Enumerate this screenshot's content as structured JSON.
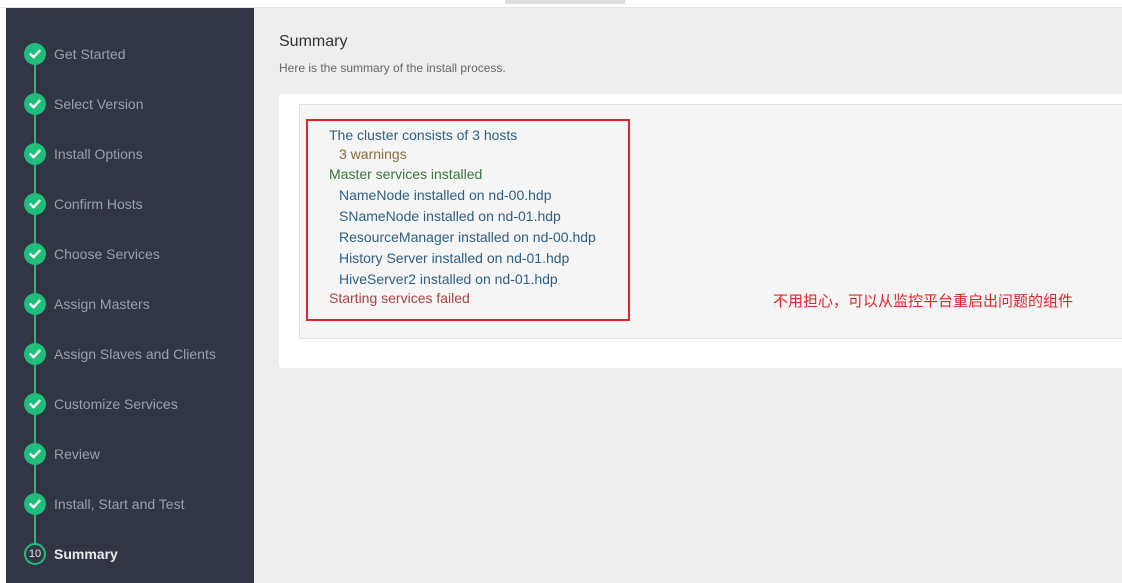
{
  "sidebar": {
    "steps": [
      {
        "label": "Get Started",
        "status": "done"
      },
      {
        "label": "Select Version",
        "status": "done"
      },
      {
        "label": "Install Options",
        "status": "done"
      },
      {
        "label": "Confirm Hosts",
        "status": "done"
      },
      {
        "label": "Choose Services",
        "status": "done"
      },
      {
        "label": "Assign Masters",
        "status": "done"
      },
      {
        "label": "Assign Slaves and Clients",
        "status": "done"
      },
      {
        "label": "Customize Services",
        "status": "done"
      },
      {
        "label": "Review",
        "status": "done"
      },
      {
        "label": "Install, Start and Test",
        "status": "done"
      },
      {
        "label": "Summary",
        "status": "current",
        "number": "10"
      }
    ],
    "check_icon": "check-icon",
    "colors": {
      "background": "#323544",
      "done": "#1fbe7a"
    }
  },
  "main": {
    "title": "Summary",
    "subtitle": "Here is the summary of the install process.",
    "summary": {
      "cluster_line": "The cluster consists of 3 hosts",
      "warnings": "3 warnings",
      "master_installed": "Master services installed",
      "components": [
        "NameNode installed on nd-00.hdp",
        "SNameNode installed on nd-01.hdp",
        "ResourceManager installed on nd-00.hdp",
        "History Server installed on nd-01.hdp",
        "HiveServer2 installed on nd-01.hdp"
      ],
      "failed": "Starting services failed"
    },
    "annotation": "不用担心，可以从监控平台重启出问题的组件",
    "colors": {
      "highlight_border": "#e0242c",
      "annotation": "#e0242c",
      "failed": "#a94442",
      "success": "#3c763d",
      "warning": "#8a6d3b",
      "info": "#2d5f83"
    }
  }
}
